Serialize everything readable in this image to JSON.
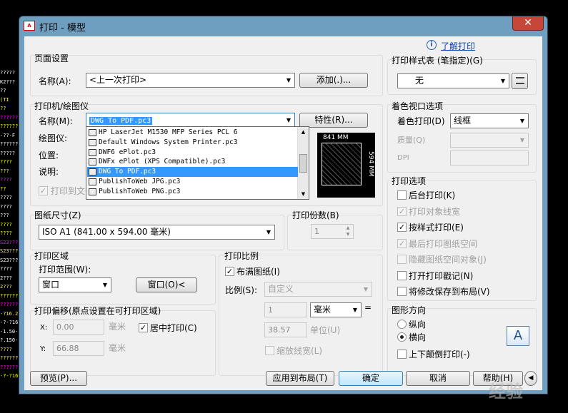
{
  "window": {
    "title": "打印 - 模型",
    "close_glyph": "✕"
  },
  "bg_labels": [
    "?????",
    "K2???",
    "??",
    "(TI",
    "??",
    "??????",
    "??????",
    "-??-F",
    "??????",
    "?????",
    "????",
    "???",
    "????",
    "??",
    "????",
    "????",
    "???",
    "????",
    "????",
    "S23???",
    "S23???",
    "S23???",
    "????",
    "2???",
    "2???",
    "??????",
    "??????",
    "-?16.2",
    "-?-?16",
    "-1.50-?",
    "?.150-?",
    "????",
    "??????",
    "??????",
    "-?-?16"
  ],
  "help": {
    "icon": "i",
    "link": "了解打印"
  },
  "page_setup": {
    "title": "页面设置",
    "name_label": "名称(A):",
    "name_value": "<上一次打印>",
    "add_button": "添加(.)..."
  },
  "printer": {
    "title": "打印机/绘图仪",
    "name_label": "名称(M):",
    "name_value": "DWG To PDF.pc3",
    "props_button": "特性(R)...",
    "plotter_label": "绘图仪:",
    "location_label": "位置:",
    "desc_label": "说明:",
    "print_to_file": "打印到文件",
    "dropdown_items": [
      "HP LaserJet M1530 MFP Series PCL 6",
      "Default Windows System Printer.pc3",
      "DWF6 ePlot.pc3",
      "DWFx ePlot (XPS Compatible).pc3",
      "DWG To PDF.pc3",
      "PublishToWeb JPG.pc3",
      "PublishToWeb PNG.pc3"
    ],
    "selected_index": 4,
    "preview": {
      "width_label": "841 MM",
      "height_label": "594 MM"
    }
  },
  "paper_size": {
    "title": "图纸尺寸(Z)",
    "value": "ISO A1 (841.00 x 594.00 毫米)"
  },
  "copies": {
    "title": "打印份数(B)",
    "value": "1"
  },
  "plot_area": {
    "title": "打印区域",
    "range_label": "打印范围(W):",
    "range_value": "窗口",
    "window_button": "窗口(O)<"
  },
  "plot_offset": {
    "title": "打印偏移(原点设置在可打印区域)",
    "x_label": "X:",
    "x_value": "0.00",
    "x_unit": "毫米",
    "y_label": "Y:",
    "y_value": "66.88",
    "y_unit": "毫米",
    "center_label": "居中打印(C)"
  },
  "plot_scale": {
    "title": "打印比例",
    "fit_label": "布满图纸(I)",
    "scale_label": "比例(S):",
    "scale_value": "自定义",
    "num_value": "1",
    "unit_value": "毫米",
    "equals": "=",
    "unit2_value": "38.57",
    "unit2_label": "单位(U)",
    "lineweight_label": "缩放线宽(L)"
  },
  "plot_style": {
    "title": "打印样式表 (笔指定)(G)",
    "value": "无"
  },
  "shaded": {
    "title": "着色视口选项",
    "shade_label": "着色打印(D)",
    "shade_value": "线框",
    "quality_label": "质量(Q)",
    "dpi_label": "DPI"
  },
  "options": {
    "title": "打印选项",
    "items": [
      {
        "label": "后台打印(K)",
        "checked": false,
        "disabled": false
      },
      {
        "label": "打印对象线宽",
        "checked": true,
        "disabled": true
      },
      {
        "label": "按样式打印(E)",
        "checked": true,
        "disabled": false
      },
      {
        "label": "最后打印图纸空间",
        "checked": true,
        "disabled": true
      },
      {
        "label": "隐藏图纸空间对象(J)",
        "checked": false,
        "disabled": true
      },
      {
        "label": "打开打印戳记(N)",
        "checked": false,
        "disabled": false
      },
      {
        "label": "将修改保存到布局(V)",
        "checked": false,
        "disabled": false
      }
    ]
  },
  "orientation": {
    "title": "图形方向",
    "portrait": "纵向",
    "landscape": "横向",
    "upside": "上下颠倒打印(-)",
    "icon_letter": "A"
  },
  "footer": {
    "preview": "预览(P)...",
    "apply": "应用到布局(T)",
    "ok": "确定",
    "cancel": "取消",
    "help": "帮助(H)"
  },
  "watermark": "经验"
}
